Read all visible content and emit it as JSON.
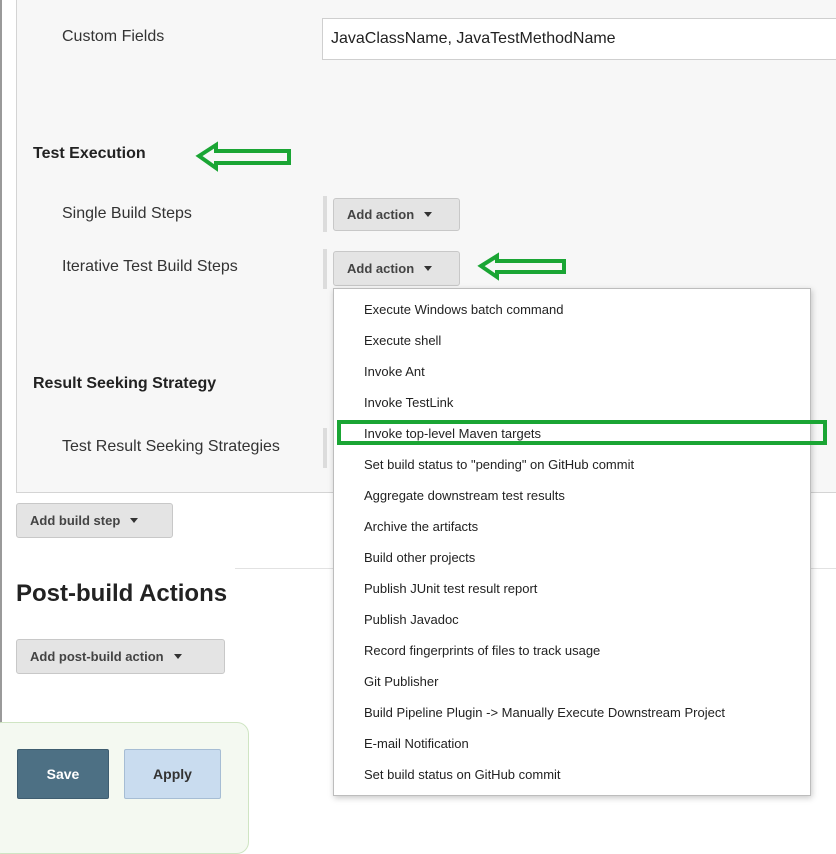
{
  "custom_fields": {
    "label": "Custom Fields",
    "value": "JavaClassName, JavaTestMethodName"
  },
  "test_execution": {
    "title": "Test Execution",
    "single_build_steps": {
      "label": "Single Build Steps",
      "button": "Add action"
    },
    "iterative_build_steps": {
      "label": "Iterative Test Build Steps",
      "button": "Add action"
    }
  },
  "dropdown": {
    "items": [
      "Execute Windows batch command",
      "Execute shell",
      "Invoke Ant",
      "Invoke TestLink",
      "Invoke top-level Maven targets",
      "Set build status to \"pending\" on GitHub commit",
      "Aggregate downstream test results",
      "Archive the artifacts",
      "Build other projects",
      "Publish JUnit test result report",
      "Publish Javadoc",
      "Record fingerprints of files to track usage",
      "Git Publisher",
      "Build Pipeline Plugin -> Manually Execute Downstream Project",
      "E-mail Notification",
      "Set build status on GitHub commit"
    ],
    "highlighted_item": "Invoke top-level Maven targets"
  },
  "result_seeking": {
    "title": "Result Seeking Strategy",
    "strategies_label": "Test Result Seeking Strategies"
  },
  "add_build_step": {
    "label": "Add build step"
  },
  "post_build": {
    "title": "Post-build Actions",
    "button": "Add post-build action"
  },
  "form_buttons": {
    "save": "Save",
    "apply": "Apply"
  },
  "colors": {
    "annotation_green": "#1aa534",
    "save_bg": "#4d7084",
    "apply_bg": "#c9dcef"
  },
  "icons": [
    "chevron-down-icon",
    "arrow-left-annotation-icon"
  ]
}
